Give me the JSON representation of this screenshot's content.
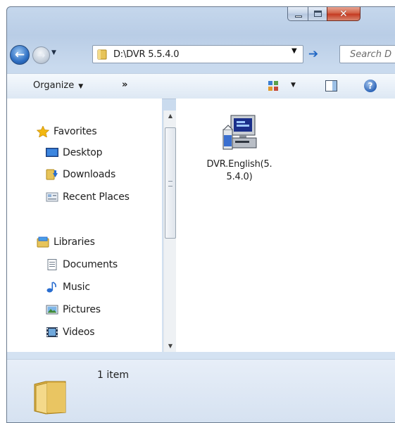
{
  "window": {
    "caption_buttons": [
      "minimize",
      "maximize",
      "close"
    ]
  },
  "address_bar": {
    "path": "D:\\DVR 5.5.4.0",
    "search_placeholder": "Search D"
  },
  "command_bar": {
    "organize_label": "Organize",
    "more_label": "»"
  },
  "nav_pane": {
    "favorites": {
      "label": "Favorites",
      "items": [
        {
          "label": "Desktop",
          "icon": "desktop-icon"
        },
        {
          "label": "Downloads",
          "icon": "downloads-icon"
        },
        {
          "label": "Recent Places",
          "icon": "recent-places-icon"
        }
      ]
    },
    "libraries": {
      "label": "Libraries",
      "items": [
        {
          "label": "Documents",
          "icon": "documents-icon"
        },
        {
          "label": "Music",
          "icon": "music-icon"
        },
        {
          "label": "Pictures",
          "icon": "pictures-icon"
        },
        {
          "label": "Videos",
          "icon": "videos-icon"
        }
      ]
    }
  },
  "content": {
    "files": [
      {
        "name": "DVR.English(5.5.4.0)",
        "icon": "installer-icon"
      }
    ]
  },
  "details_pane": {
    "item_count": "1 item"
  },
  "colors": {
    "frame": "#b9cde6",
    "accent": "#2e6fc3",
    "close": "#c4371f"
  }
}
